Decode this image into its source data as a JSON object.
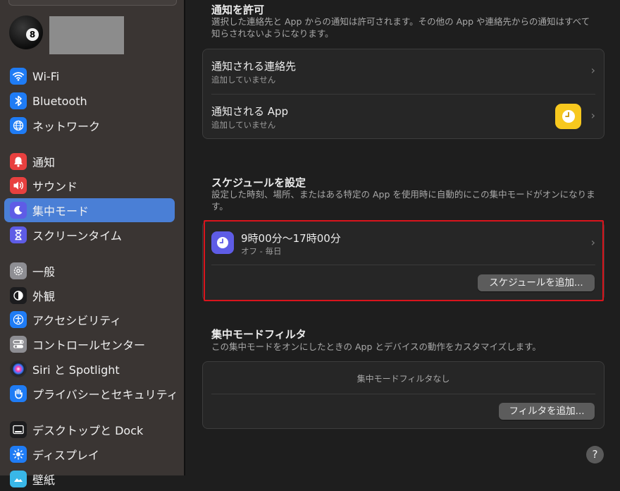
{
  "sidebar": {
    "avatar_glyph": "8",
    "items": [
      {
        "label": "Wi-Fi",
        "icon": "wifi-icon",
        "color": "#1f7cf5"
      },
      {
        "label": "Bluetooth",
        "icon": "bluetooth-icon",
        "color": "#1f7cf5"
      },
      {
        "label": "ネットワーク",
        "icon": "globe-icon",
        "color": "#1f7cf5"
      },
      {
        "label": "通知",
        "icon": "bell-icon",
        "color": "#e8403f"
      },
      {
        "label": "サウンド",
        "icon": "speaker-icon",
        "color": "#e8403f"
      },
      {
        "label": "集中モード",
        "icon": "moon-icon",
        "color": "#5e5ce6"
      },
      {
        "label": "スクリーンタイム",
        "icon": "hourglass-icon",
        "color": "#5e5ce6"
      },
      {
        "label": "一般",
        "icon": "gear-icon",
        "color": "#8e8e93"
      },
      {
        "label": "外観",
        "icon": "appearance-icon",
        "color": "#1c1c1e"
      },
      {
        "label": "アクセシビリティ",
        "icon": "accessibility-icon",
        "color": "#1f7cf5"
      },
      {
        "label": "コントロールセンター",
        "icon": "toggles-icon",
        "color": "#8e8e93"
      },
      {
        "label": "Siri と Spotlight",
        "icon": "siri-icon",
        "color": "#2b2b2b"
      },
      {
        "label": "プライバシーとセキュリティ",
        "icon": "hand-icon",
        "color": "#1f7cf5"
      },
      {
        "label": "デスクトップと Dock",
        "icon": "dock-icon",
        "color": "#1c1c1e"
      },
      {
        "label": "ディスプレイ",
        "icon": "sun-icon",
        "color": "#1f7cf5"
      },
      {
        "label": "壁紙",
        "icon": "wallpaper-icon",
        "color": "#39b7e8"
      }
    ],
    "active_label": "集中モード"
  },
  "allow": {
    "title": "通知を許可",
    "desc": "選択した連絡先と App からの通知は許可されます。その他の App や連絡先からの通知はすべて知らされないようになります。",
    "rows": [
      {
        "title": "通知される連絡先",
        "sub": "追加していません"
      },
      {
        "title": "通知される App",
        "sub": "追加していません",
        "app_icon": "clock-icon"
      }
    ]
  },
  "schedule": {
    "title": "スケジュールを設定",
    "desc": "設定した時刻、場所、またはある特定の App を使用時に自動的にこの集中モードがオンになります。",
    "item_title": "9時00分〜17時00分",
    "item_sub": "オフ - 毎日",
    "add_button": "スケジュールを追加..."
  },
  "filters": {
    "title": "集中モードフィルタ",
    "desc": "この集中モードをオンにしたときの App とデバイスの動作をカスタマイズします。",
    "empty": "集中モードフィルタなし",
    "add_button": "フィルタを追加..."
  },
  "help_label": "?",
  "colors": {
    "accent": "#4a7fd6",
    "highlight": "#d9141c",
    "schedule_icon": "#5e5ce6",
    "app_icon": "#f7c81e"
  }
}
